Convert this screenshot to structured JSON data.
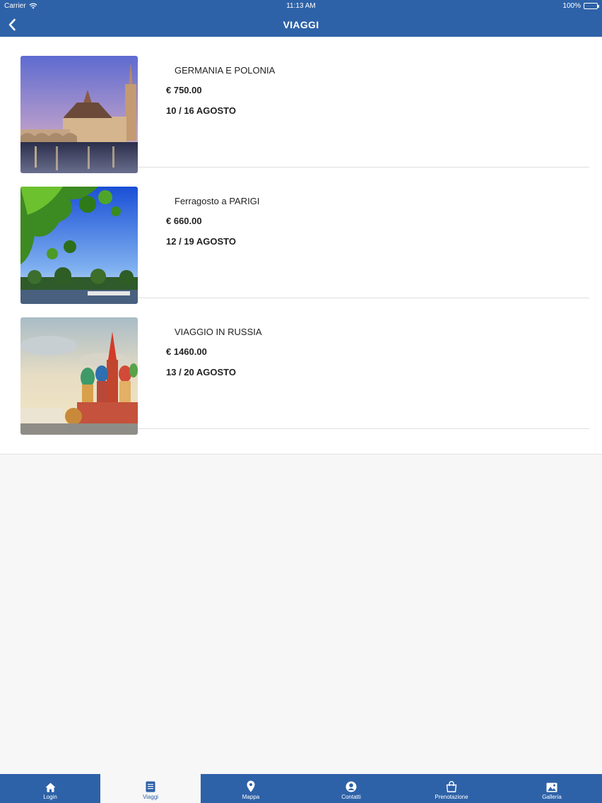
{
  "status_bar": {
    "carrier": "Carrier",
    "time": "11:13 AM",
    "battery": "100%"
  },
  "navbar": {
    "title": "VIAGGI",
    "back_icon": "chevron-left-icon"
  },
  "trips": [
    {
      "name": "GERMANIA E POLONIA",
      "price": "€ 750.00",
      "dates": "10 / 16 AGOSTO"
    },
    {
      "name": "Ferragosto a PARIGI",
      "price": "€ 660.00",
      "dates": "12 / 19 AGOSTO"
    },
    {
      "name": "VIAGGIO IN RUSSIA",
      "price": "€ 1460.00",
      "dates": "13 / 20 AGOSTO"
    }
  ],
  "tabs": [
    {
      "label": "Login",
      "icon": "home-icon"
    },
    {
      "label": "Viaggi",
      "icon": "list-icon",
      "active": true
    },
    {
      "label": "Mappa",
      "icon": "map-pin-icon"
    },
    {
      "label": "Contatti",
      "icon": "contact-icon"
    },
    {
      "label": "Prenotazione",
      "icon": "shopping-bag-icon"
    },
    {
      "label": "Galleria",
      "icon": "image-icon"
    }
  ],
  "colors": {
    "primary": "#2e62a8",
    "background": "#f7f7f8",
    "text": "#222222"
  }
}
